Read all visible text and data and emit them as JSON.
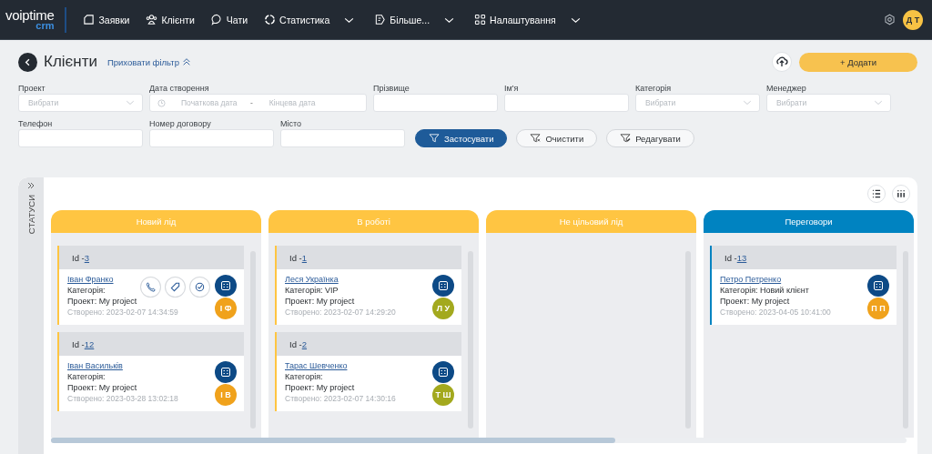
{
  "nav": {
    "logo": "voiptime",
    "logo_sub": "crm",
    "items": [
      {
        "label": "Заявки",
        "kind": "requests",
        "dropdown": false
      },
      {
        "label": "Клієнти",
        "kind": "clients",
        "dropdown": false
      },
      {
        "label": "Чати",
        "kind": "chats",
        "dropdown": false
      },
      {
        "label": "Статистика",
        "kind": "stats",
        "dropdown": true
      },
      {
        "label": "Більше...",
        "kind": "more",
        "dropdown": true
      },
      {
        "label": "Налаштування",
        "kind": "settings",
        "dropdown": true
      }
    ],
    "user_initials": "Д Т"
  },
  "header": {
    "title": "Клієнти",
    "filter_toggle": "Приховати фільтр",
    "add_button": "+ Додати"
  },
  "filters": [
    [
      {
        "label": "Проект",
        "kind": "select",
        "placeholder": "Вибрати"
      },
      {
        "label": "Дата створення",
        "kind": "date",
        "placeholder": "Початкова дата",
        "placeholder_end": "Кінцева дата",
        "separator": "-"
      },
      {
        "label": "Прізвище",
        "kind": "text"
      },
      {
        "label": "Ім'я",
        "kind": "text"
      },
      {
        "label": "Категорія",
        "kind": "select",
        "placeholder": "Вибрати"
      },
      {
        "label": "Менеджер",
        "kind": "select",
        "placeholder": "Вибрати"
      }
    ],
    [
      {
        "label": "Телефон",
        "kind": "text"
      },
      {
        "label": "Номер договору",
        "kind": "text"
      },
      {
        "label": "Місто",
        "kind": "text"
      }
    ]
  ],
  "filter_buttons": [
    {
      "label": "Застосувати",
      "kind": "apply"
    },
    {
      "label": "Очистити",
      "kind": "clear"
    },
    {
      "label": "Редагувати",
      "kind": "edit"
    }
  ],
  "board": {
    "sidebar_label": "СТАТУСИ",
    "columns": [
      {
        "title": "Новий лід",
        "color": "#ffc542",
        "cards": [
          {
            "id_label": "Id -",
            "id": "3",
            "name": "Іван Франко",
            "category": "Категорія:",
            "project": "Проект: My project",
            "created": "Створено: 2023-02-07 14:34:59",
            "initials": "І Ф",
            "color": "#f0a21c",
            "actions_shown": true
          },
          {
            "id_label": "Id -",
            "id": "12",
            "name": "Іван Васильків",
            "category": "Категорія:",
            "project": "Проект: My project",
            "created": "Створено: 2023-03-28 13:02:18",
            "initials": "І В",
            "color": "#f0a21c",
            "actions_shown": false
          }
        ]
      },
      {
        "title": "В роботі",
        "color": "#ffc542",
        "cards": [
          {
            "id_label": "Id -",
            "id": "1",
            "name": "Леся Українка",
            "category": "Категорія: VIP",
            "project": "Проект: My project",
            "created": "Створено: 2023-02-07 14:29:20",
            "initials": "Л У",
            "color": "#a3a91e",
            "actions_shown": false
          },
          {
            "id_label": "Id -",
            "id": "2",
            "name": "Тарас Шевченко",
            "category": "Категорія:",
            "project": "Проект: My project",
            "created": "Створено: 2023-02-07 14:30:16",
            "initials": "Т Ш",
            "color": "#a3a91e",
            "actions_shown": false
          }
        ]
      },
      {
        "title": "Не цільовий лід",
        "color": "#ffc542"
      },
      {
        "title": "Переговори",
        "color": "#0083c1",
        "cards": [
          {
            "id_label": "Id -",
            "id": "13",
            "name": "Петро Петренко",
            "category": "Категорія: Новий клієнт",
            "project": "Проект: My project",
            "created": "Створено: 2023-04-05 10:41:00",
            "initials": "П П",
            "color": "#f0a21c",
            "actions_shown": false
          }
        ]
      }
    ]
  }
}
